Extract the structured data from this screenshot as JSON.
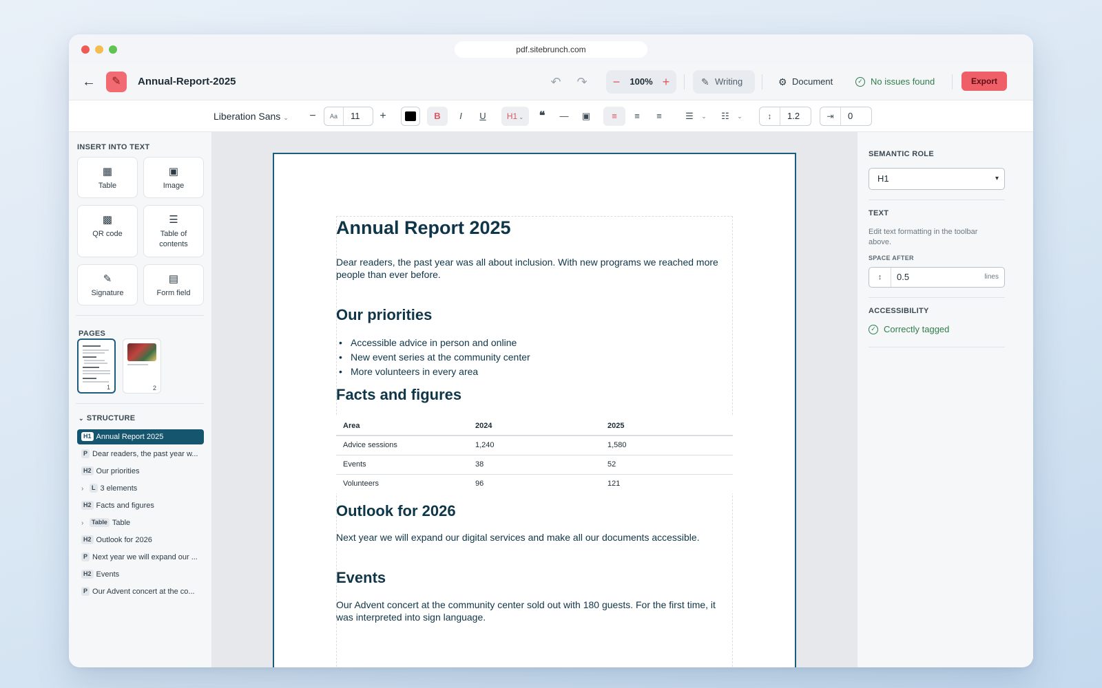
{
  "browser": {
    "url": "pdf.sitebrunch.com"
  },
  "header": {
    "doc_title": "Annual-Report-2025",
    "zoom": "100%",
    "mode_label": "Writing",
    "document_label": "Document",
    "issues_label": "No issues found",
    "export_label": "Export"
  },
  "toolbar": {
    "font_family": "Liberation Sans",
    "font_size_prefix": "Aa",
    "font_size": "11",
    "bold": "B",
    "italic": "I",
    "underline": "U",
    "heading_level": "H1",
    "line_spacing": "1.2",
    "indent": "0",
    "text_color": "#000000"
  },
  "insert": {
    "title": "INSERT INTO TEXT",
    "items": [
      "Table",
      "Image",
      "QR code",
      "Table of contents",
      "Signature",
      "Form field"
    ]
  },
  "pages": {
    "title": "PAGES",
    "items": [
      "1",
      "2"
    ],
    "selected": "1"
  },
  "structure": {
    "title": "STRUCTURE",
    "items": [
      {
        "tag": "H1",
        "label": "Annual Report 2025"
      },
      {
        "tag": "P",
        "label": "Dear readers, the past year w..."
      },
      {
        "tag": "H2",
        "label": "Our priorities"
      },
      {
        "tag": "L",
        "label": "3 elements"
      },
      {
        "tag": "H2",
        "label": "Facts and figures"
      },
      {
        "tag": "Table",
        "label": "Table"
      },
      {
        "tag": "H2",
        "label": "Outlook for 2026"
      },
      {
        "tag": "P",
        "label": "Next year we will expand our ..."
      },
      {
        "tag": "H2",
        "label": "Events"
      },
      {
        "tag": "P",
        "label": "Our Advent concert at the co..."
      }
    ]
  },
  "document": {
    "h1": "Annual Report 2025",
    "intro": "Dear readers, the past year was all about inclusion. With new programs we reached more people than ever before.",
    "priorities_heading": "Our priorities",
    "priorities": [
      "Accessible advice in person and online",
      "New event series at the community center",
      "More volunteers in every area"
    ],
    "facts_heading": "Facts and figures",
    "table": {
      "headers": [
        "Area",
        "2024",
        "2025"
      ],
      "rows": [
        [
          "Advice sessions",
          "1,240",
          "1,580"
        ],
        [
          "Events",
          "38",
          "52"
        ],
        [
          "Volunteers",
          "96",
          "121"
        ]
      ]
    },
    "outlook_heading": "Outlook for 2026",
    "outlook_text": "Next year we will expand our digital services and make all our documents accessible.",
    "events_heading": "Events",
    "events_text": "Our Advent concert at the community center sold out with 180 guests. For the first time, it was interpreted into sign language."
  },
  "properties": {
    "semantic_role_title": "SEMANTIC ROLE",
    "semantic_role_value": "H1",
    "text_title": "TEXT",
    "text_help": "Edit text formatting in the toolbar above.",
    "space_after_label": "SPACE AFTER",
    "space_after_value": "0.5",
    "space_after_unit": "lines",
    "accessibility_title": "ACCESSIBILITY",
    "accessibility_status": "Correctly tagged"
  },
  "colors": {
    "accent": "#15556e",
    "export": "#ef5f68",
    "success": "#2f7d4a",
    "heading_text": "#0f3548"
  }
}
